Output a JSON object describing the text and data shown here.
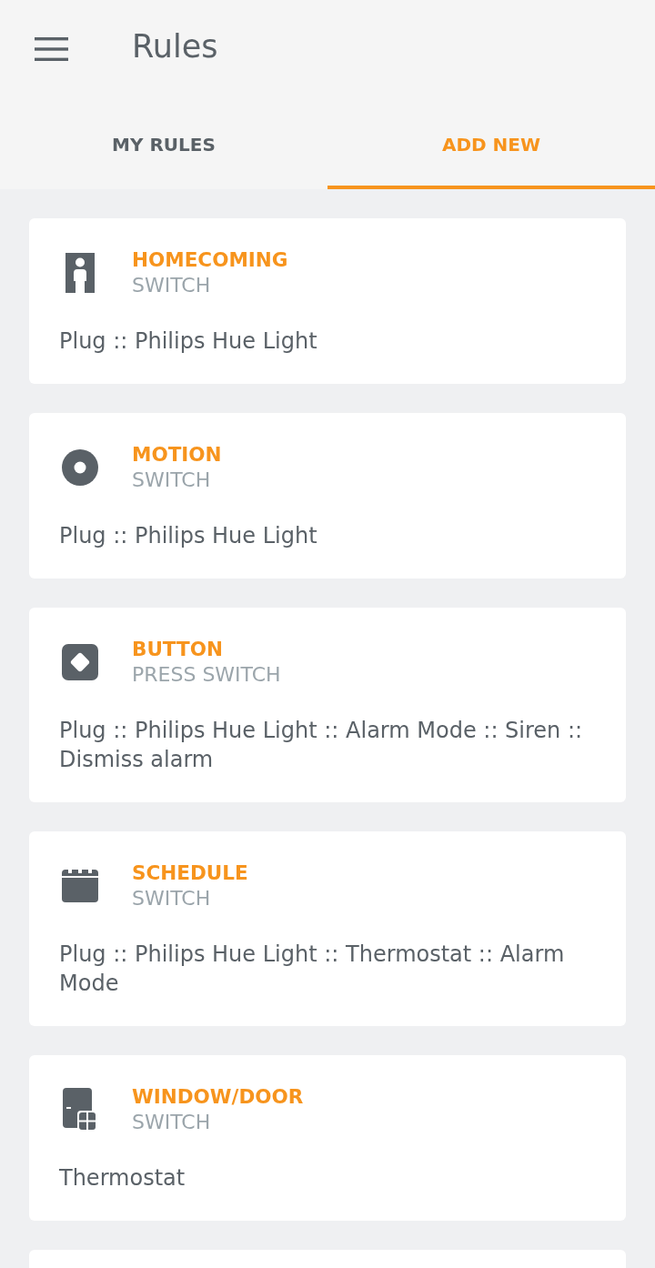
{
  "app_bar": {
    "title": "Rules"
  },
  "tabs": [
    {
      "label": "MY RULES",
      "selected": false
    },
    {
      "label": "ADD NEW",
      "selected": true
    }
  ],
  "rules": [
    {
      "kind": "presence",
      "name": "HOMECOMING",
      "type": "SWITCH",
      "actions": "Plug :: Philips Hue Light"
    },
    {
      "kind": "motion",
      "name": "MOTION",
      "type": "SWITCH",
      "actions": "Plug :: Philips Hue Light"
    },
    {
      "kind": "button",
      "name": "BUTTON",
      "type": "PRESS SWITCH",
      "actions": "Plug :: Philips Hue Light :: Alarm Mode :: Siren :: Dismiss alarm"
    },
    {
      "kind": "schedule",
      "name": "SCHEDULE",
      "type": "SWITCH",
      "actions": "Plug :: Philips Hue Light :: Thermostat :: Alarm Mode"
    },
    {
      "kind": "contact",
      "name": "WINDOW/DOOR",
      "type": "SWITCH",
      "actions": "Thermostat"
    }
  ],
  "more_below": true
}
